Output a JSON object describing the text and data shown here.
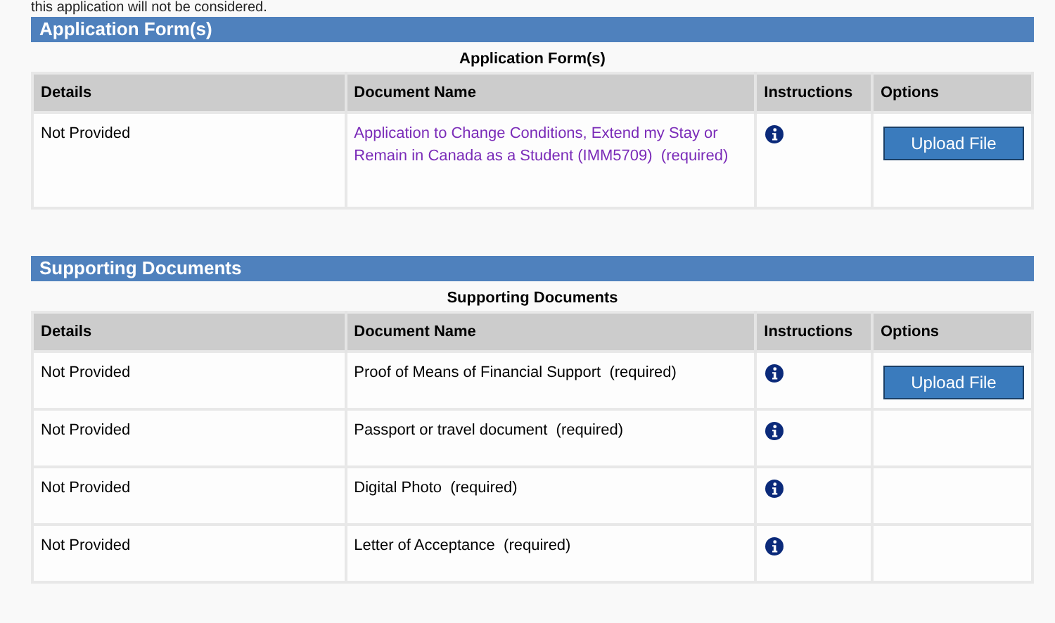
{
  "intro_text": "this application will not be considered.",
  "sections": [
    {
      "title": "Application Form(s)",
      "caption": "Application Form(s)",
      "columns": [
        "Details",
        "Document Name",
        "Instructions",
        "Options"
      ],
      "rows": [
        {
          "details": "Not Provided",
          "document_name": "Application to Change Conditions, Extend my Stay or Remain in Canada as a Student (IMM5709)  (required)",
          "linked": true,
          "option_button": "Upload File"
        }
      ]
    },
    {
      "title": "Supporting Documents",
      "caption": "Supporting Documents",
      "columns": [
        "Details",
        "Document Name",
        "Instructions",
        "Options"
      ],
      "rows": [
        {
          "details": "Not Provided",
          "document_name": "Proof of Means of Financial Support  (required)",
          "linked": false,
          "option_button": "Upload File"
        },
        {
          "details": "Not Provided",
          "document_name": "Passport or travel document  (required)",
          "linked": false
        },
        {
          "details": "Not Provided",
          "document_name": "Digital Photo  (required)",
          "linked": false
        },
        {
          "details": "Not Provided",
          "document_name": "Letter of Acceptance  (required)",
          "linked": false
        }
      ]
    }
  ]
}
